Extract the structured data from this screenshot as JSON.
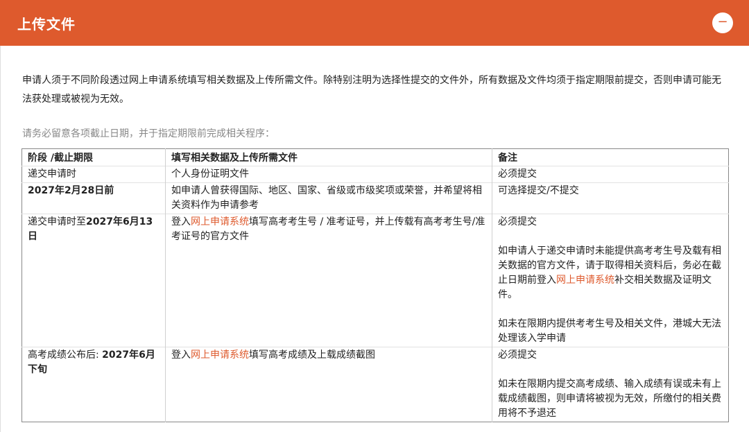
{
  "header": {
    "title": "上传文件",
    "collapse_icon": "−"
  },
  "intro": {
    "text": "申请人须于不同阶段透过网上申请系统填写相关数据及上传所需文件。除特别注明为选择性提交的文件外，所有数据及文件均须于指定期限前提交，否则申请可能无法获处理或被视为无效。"
  },
  "notice": {
    "text": "请务必留意各项截止日期，并于指定期限前完成相关程序："
  },
  "table": {
    "headers": {
      "stage": "阶段 /截止期限",
      "files": "填写相关数据及上传所需文件",
      "remarks": "备注"
    },
    "rows": [
      {
        "stage": "递交申请时",
        "files": "个人身份证明文件",
        "remark": "必须提交"
      },
      {
        "stage": "2027年2月28日前",
        "files": "如申请人曾获得国际、地区、国家、省级或市级奖项或荣誉，并希望将相关资料作为申请参考",
        "remark": "可选择提交/不提交"
      },
      {
        "stage_pre": "递交申请时至",
        "stage_bold": "2027年6月13日",
        "files_pre": "登入",
        "files_link": "网上申请系统",
        "files_post": "填写高考考生号 / 准考证号，并上传载有高考考生号/准考证号的官方文件",
        "remark_1": "必须提交",
        "remark_2_pre": "如申请人于递交申请时未能提供高考考生号及载有相关数据的官方文件，请于取得相关资料后，务必在截止日期前登入",
        "remark_2_link": "网上申请系统",
        "remark_2_post": "补交相关数据及证明文件。",
        "remark_3": "如未在限期内提供考考生号及相关文件，港城大无法处理该入学申请"
      },
      {
        "stage_pre": "高考成绩公布后: ",
        "stage_bold": "2027年6月下旬",
        "files_pre": "登入",
        "files_link": "网上申请系统",
        "files_post": "填写高考成绩及上载成绩截图",
        "remark_1": "必须提交",
        "remark_2": "如未在限期内提交高考成绩、输入成绩有误或未有上载成绩截图，则申请将被视为无效，所缴付的相关费用将不予退还"
      }
    ]
  }
}
